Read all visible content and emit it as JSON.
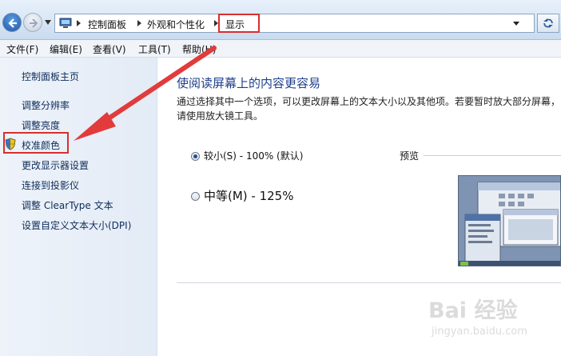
{
  "address_bar": {
    "breadcrumbs": [
      "控制面板",
      "外观和个性化",
      "显示"
    ]
  },
  "menu": {
    "items": [
      "文件(F)",
      "编辑(E)",
      "查看(V)",
      "工具(T)",
      "帮助(H)"
    ]
  },
  "sidebar": {
    "home": "控制面板主页",
    "links": [
      "调整分辨率",
      "调整亮度",
      "校准颜色",
      "更改显示器设置",
      "连接到投影仪",
      "调整 ClearType 文本",
      "设置自定义文本大小(DPI)"
    ]
  },
  "main": {
    "title": "使阅读屏幕上的内容更容易",
    "description": "通过选择其中一个选项，可以更改屏幕上的文本大小以及其他项。若要暂时放大部分屏幕，请使用放大镜工具。",
    "options": [
      {
        "label": "较小(S) - 100% (默认)",
        "selected": true
      },
      {
        "label": "中等(M) - 125%",
        "selected": false
      }
    ],
    "preview_label": "预览"
  },
  "watermark": {
    "text": "Bai 经验",
    "url": "jingyan.baidu.com"
  },
  "colors": {
    "annotation_red": "#d82f2f",
    "title_blue": "#1e3f8a"
  }
}
